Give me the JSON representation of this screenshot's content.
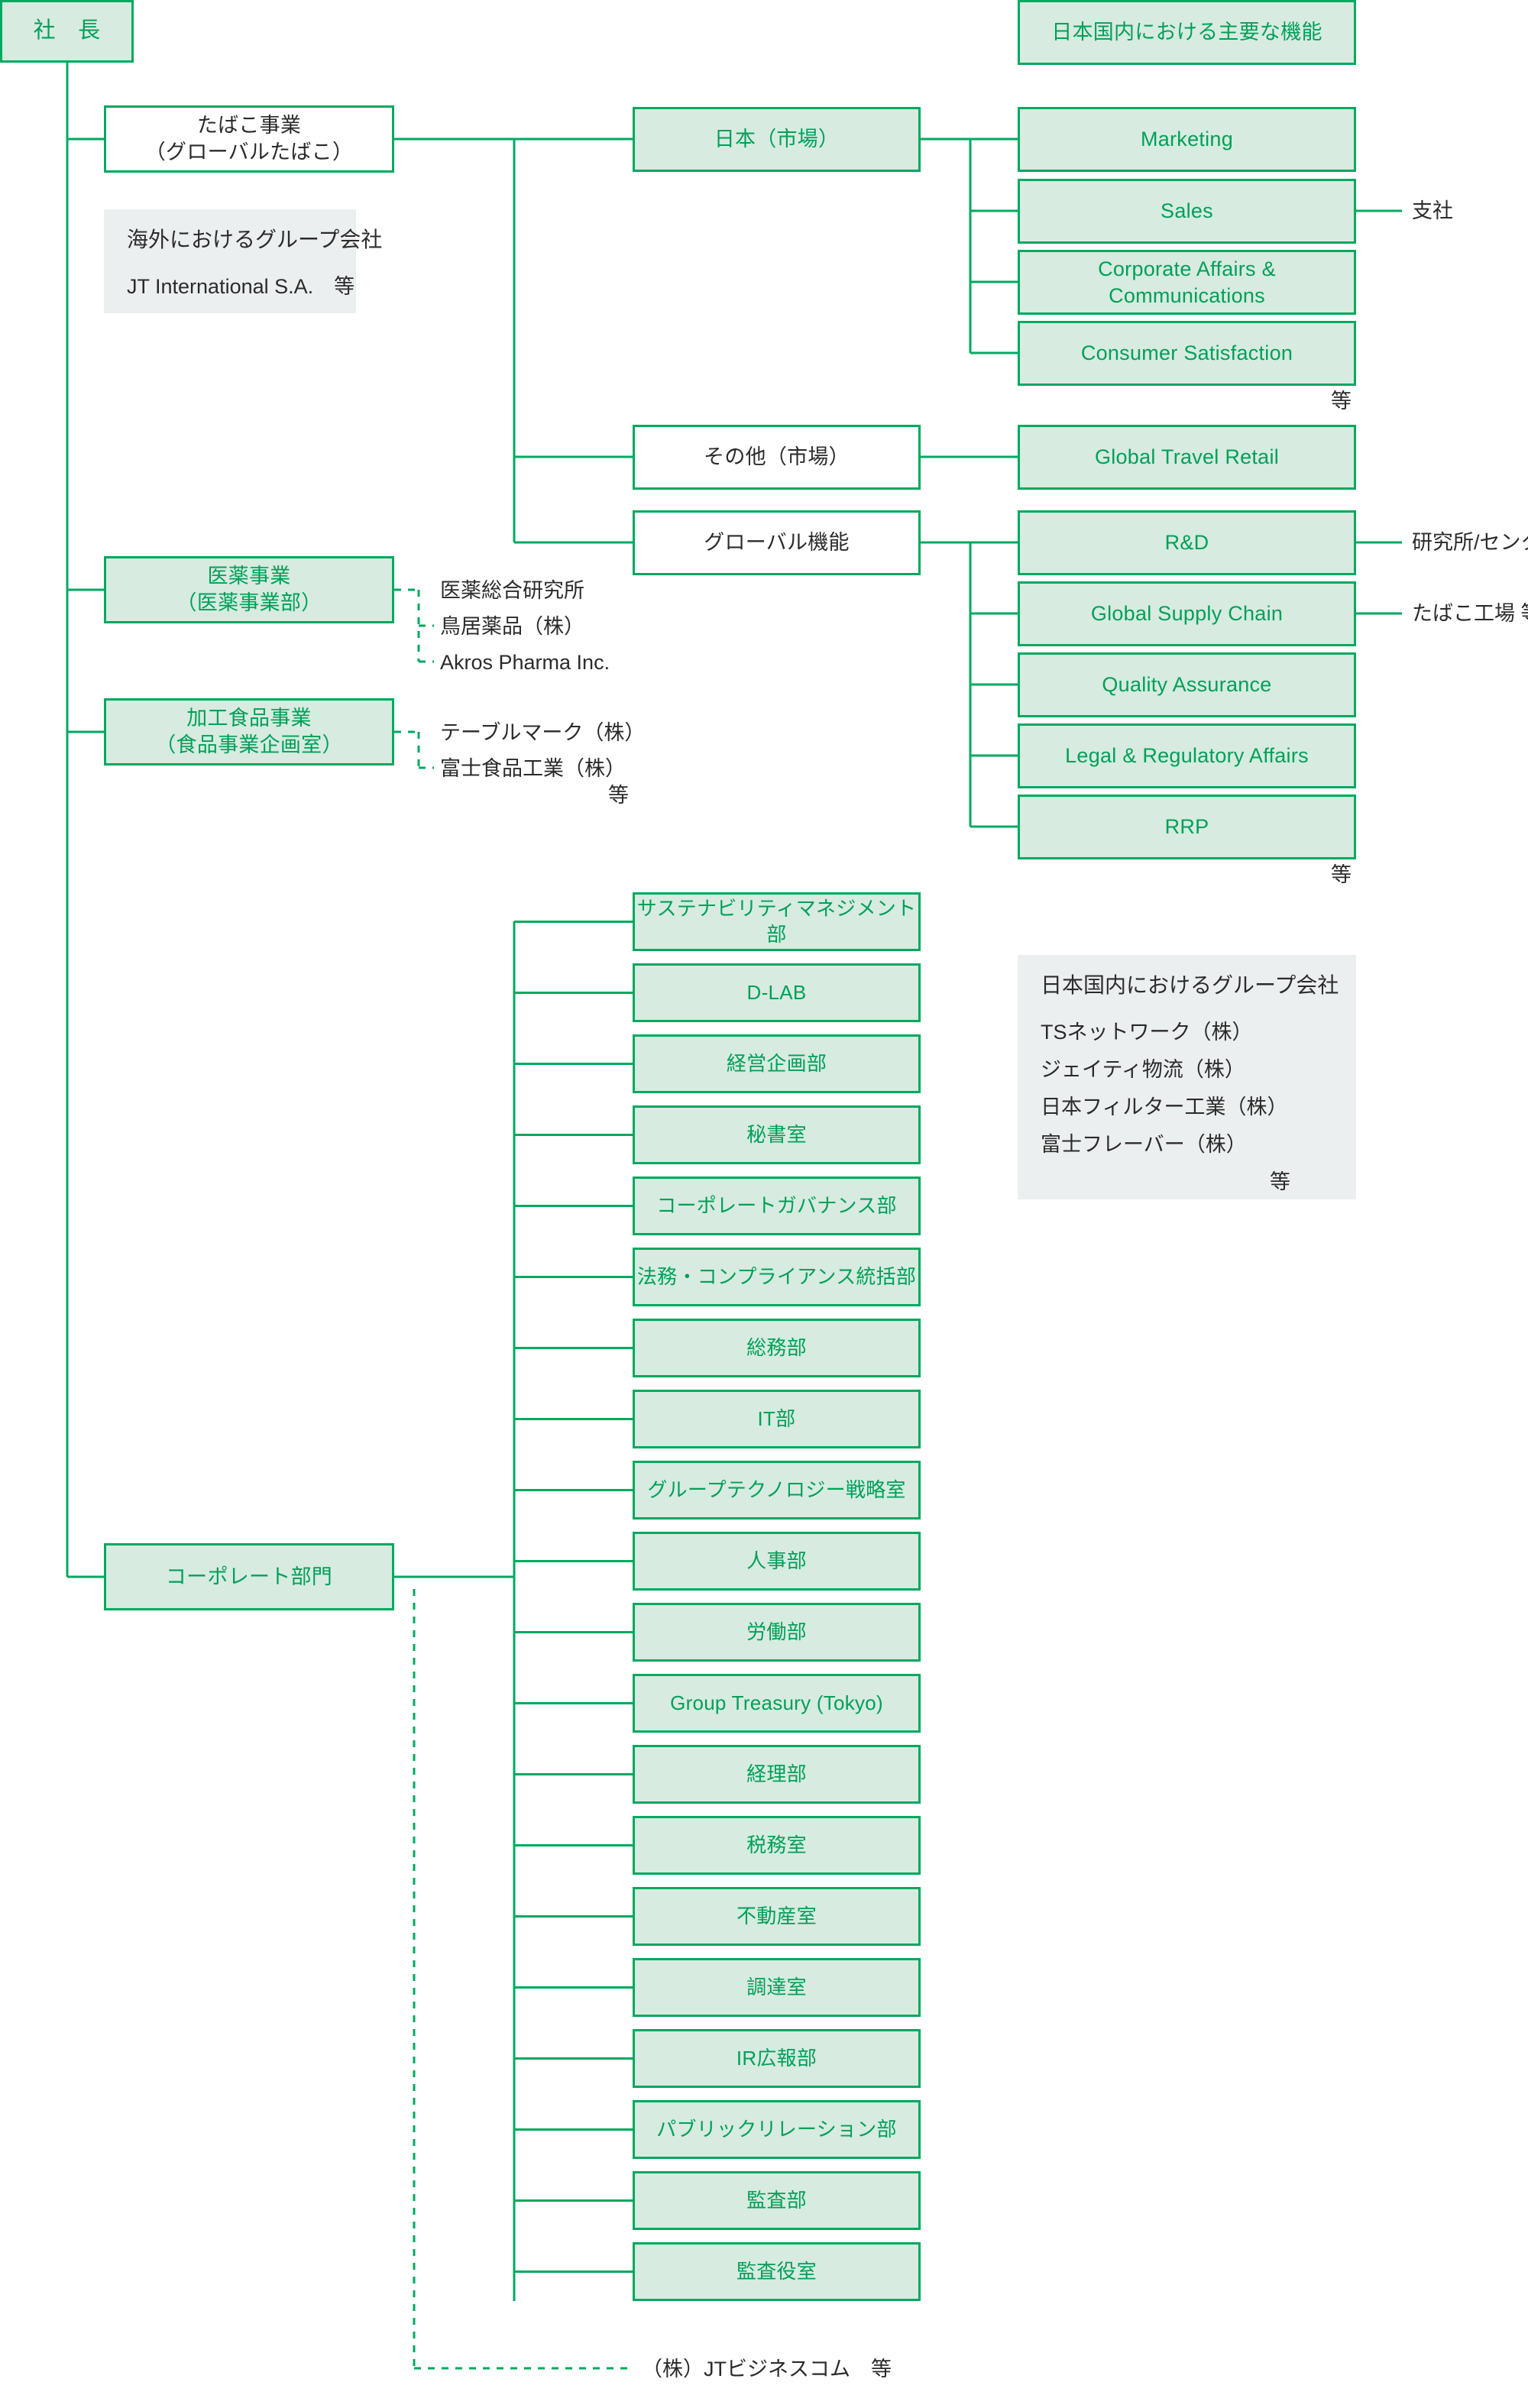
{
  "colors": {
    "line": "#00a960",
    "fill": "#d7ebe0",
    "accent_text": "#00a05a",
    "panel_bg": "#eceff0",
    "dark_text": "#2b2b2b"
  },
  "root": {
    "label": "社　長"
  },
  "legend": {
    "domestic_functions_header": "日本国内における主要な機能"
  },
  "divisions": [
    {
      "label": "たばこ事業\n（グローバルたばこ）"
    },
    {
      "label": "医薬事業\n（医薬事業部）"
    },
    {
      "label": "加工食品事業\n（食品事業企画室）"
    },
    {
      "label": "コーポレート部門"
    }
  ],
  "markets": [
    {
      "label": "日本（市場）"
    },
    {
      "label": "その他（市場）"
    },
    {
      "label": "グローバル機能"
    }
  ],
  "japan_functions": [
    {
      "label": "Marketing"
    },
    {
      "label": "Sales",
      "side_note": "支社"
    },
    {
      "label": "Corporate Affairs & Communications"
    },
    {
      "label": "Consumer Satisfaction"
    }
  ],
  "japan_functions_etc": "等",
  "other_market_functions": [
    {
      "label": "Global Travel Retail"
    }
  ],
  "global_functions": [
    {
      "label": "R&D",
      "side_note": "研究所/センター"
    },
    {
      "label": "Global Supply Chain",
      "side_note": "たばこ工場 等"
    },
    {
      "label": "Quality Assurance"
    },
    {
      "label": "Legal & Regulatory Affairs"
    },
    {
      "label": "RRP"
    }
  ],
  "global_functions_etc": "等",
  "overseas_group_panel": {
    "title": "海外におけるグループ会社",
    "companies": [
      "JT International S.A.　等"
    ]
  },
  "domestic_group_panel": {
    "title": "日本国内におけるグループ会社",
    "companies": [
      "TSネットワーク（株）",
      "ジェイティ物流（株）",
      "日本フィルター工業（株）",
      "富士フレーバー（株）"
    ],
    "note": "等"
  },
  "pharma_subsidiaries": [
    "医薬総合研究所",
    "鳥居薬品（株）",
    "Akros Pharma Inc."
  ],
  "food_subsidiaries": [
    "テーブルマーク（株）",
    "富士食品工業（株）"
  ],
  "food_etc": "等",
  "corporate_departments": [
    {
      "label": "サステナビリティマネジメント部"
    },
    {
      "label": "D-LAB"
    },
    {
      "label": "経営企画部"
    },
    {
      "label": "秘書室"
    },
    {
      "label": "コーポレートガバナンス部"
    },
    {
      "label": "法務・コンプライアンス統括部"
    },
    {
      "label": "総務部"
    },
    {
      "label": "IT部"
    },
    {
      "label": "グループテクノロジー戦略室"
    },
    {
      "label": "人事部"
    },
    {
      "label": "労働部"
    },
    {
      "label": "Group Treasury (Tokyo)"
    },
    {
      "label": "経理部"
    },
    {
      "label": "税務室"
    },
    {
      "label": "不動産室"
    },
    {
      "label": "調達室"
    },
    {
      "label": "IR広報部"
    },
    {
      "label": "パブリックリレーション部"
    },
    {
      "label": "監査部"
    },
    {
      "label": "監査役室"
    }
  ],
  "corporate_affiliate": "（株）JTビジネスコム　等"
}
